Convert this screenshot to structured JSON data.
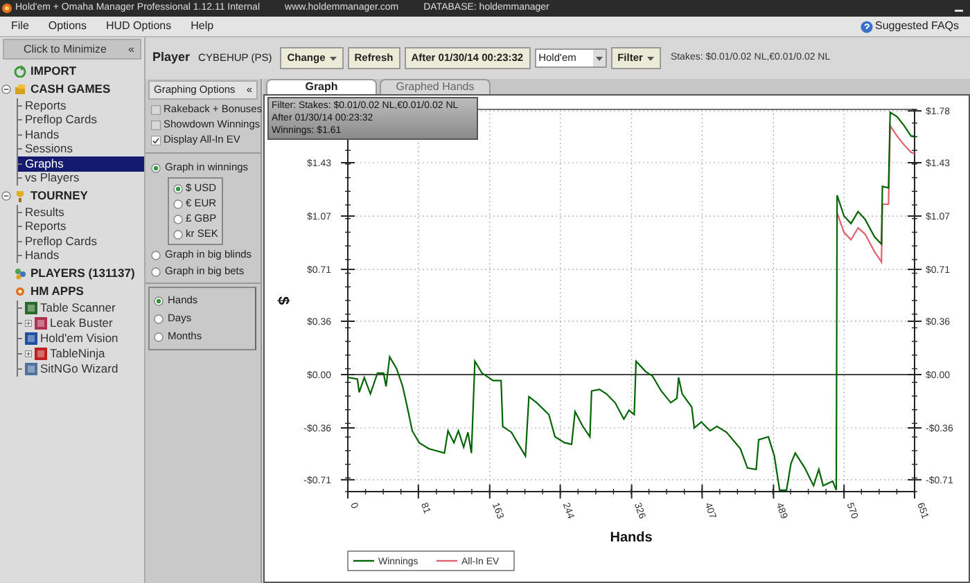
{
  "window": {
    "title": "Hold'em + Omaha Manager Professional 1.12.11 Internal",
    "website": "www.holdemmanager.com",
    "database": "DATABASE: holdemmanager"
  },
  "menu": [
    "File",
    "Options",
    "HUD Options",
    "Help"
  ],
  "help_link": "Suggested FAQs",
  "sidebar": {
    "header": "Click to Minimize",
    "collapse": "«",
    "items": [
      {
        "label": "IMPORT",
        "selected": false
      },
      {
        "label": "CASH GAMES",
        "selected": false,
        "expanded": true,
        "children": [
          {
            "label": "Reports",
            "selected": false
          },
          {
            "label": "Preflop Cards",
            "selected": false
          },
          {
            "label": "Hands",
            "selected": false
          },
          {
            "label": "Sessions",
            "selected": false
          },
          {
            "label": "Graphs",
            "selected": true
          },
          {
            "label": "vs Players",
            "selected": false
          }
        ]
      },
      {
        "label": "TOURNEY",
        "selected": false,
        "expanded": true,
        "children": [
          {
            "label": "Results",
            "selected": false
          },
          {
            "label": "Reports",
            "selected": false
          },
          {
            "label": "Preflop Cards",
            "selected": false
          },
          {
            "label": "Hands",
            "selected": false
          }
        ]
      },
      {
        "label": "PLAYERS (131137)",
        "selected": false
      },
      {
        "label": "HM APPS",
        "selected": false,
        "children": [
          {
            "label": "Table Scanner",
            "selected": false
          },
          {
            "label": "Leak Buster",
            "selected": false,
            "expanded": false
          },
          {
            "label": "Hold'em Vision",
            "selected": false
          },
          {
            "label": "TableNinja",
            "selected": false,
            "expanded": false
          },
          {
            "label": "SitNGo Wizard",
            "selected": false
          }
        ]
      }
    ]
  },
  "toolbar": {
    "player_label": "Player",
    "player": "CYBEHUP (PS)",
    "buttons": [
      {
        "label": "Change",
        "kind": "dropdown"
      },
      {
        "label": "Refresh",
        "kind": "plain"
      },
      {
        "label": "After 01/30/14 00:23:32",
        "kind": "plain"
      }
    ],
    "game": "Hold'em",
    "filter": "Filter",
    "stakes": "Stakes: $0.01/0.02 NL,€0.01/0.02 NL"
  },
  "options": {
    "title": "Graphing Options",
    "collapse": "«",
    "checkboxes": [
      {
        "label": "Rakeback + Bonuses",
        "checked": false
      },
      {
        "label": "Showdown Winnings",
        "checked": false
      },
      {
        "label": "Display All-In EV",
        "checked": true
      }
    ],
    "units": [
      {
        "label": "Graph in winnings",
        "selected": true,
        "currencies": [
          {
            "label": "$ USD",
            "selected": true
          },
          {
            "label": "€ EUR",
            "selected": false
          },
          {
            "label": "£ GBP",
            "selected": false
          },
          {
            "label": "kr SEK",
            "selected": false
          }
        ]
      },
      {
        "label": "Graph in big blinds",
        "selected": false
      },
      {
        "label": "Graph in big bets",
        "selected": false
      }
    ],
    "period": [
      {
        "label": "Hands",
        "selected": true
      },
      {
        "label": "Days",
        "selected": false
      },
      {
        "label": "Months",
        "selected": false
      }
    ]
  },
  "tabs": [
    {
      "label": "Graph",
      "selected": true
    },
    {
      "label": "Graphed Hands",
      "selected": false
    }
  ],
  "filter_box": [
    "Filter: Stakes: $0.01/0.02 NL,€0.01/0.02 NL",
    "After 01/30/14 00:23:32",
    "Winnings: $1.61"
  ],
  "chart_data": {
    "type": "line",
    "grid": true,
    "legend": true,
    "xlabel": "Hands",
    "ylabel": "$",
    "xlim": [
      0,
      651
    ],
    "ylim": [
      -0.79,
      1.79
    ],
    "xticks": [
      0,
      81,
      163,
      244,
      326,
      407,
      489,
      570,
      651
    ],
    "yticks": [
      {
        "value": -0.71,
        "label": "-$0.71"
      },
      {
        "value": -0.36,
        "label": "-$0.36"
      },
      {
        "value": 0,
        "label": "$0.00"
      },
      {
        "value": 0.36,
        "label": "$0.36"
      },
      {
        "value": 0.71,
        "label": "$0.71"
      },
      {
        "value": 1.07,
        "label": "$1.07"
      },
      {
        "value": 1.43,
        "label": "$1.43"
      },
      {
        "value": 1.78,
        "label": "$1.78"
      }
    ],
    "x": [
      0,
      11,
      13,
      19,
      26,
      34,
      41,
      44,
      48,
      56,
      63,
      69,
      74,
      82,
      93,
      111,
      115,
      122,
      127,
      133,
      138,
      142,
      146,
      154,
      167,
      176,
      178,
      188,
      196,
      204,
      208,
      217,
      231,
      238,
      249,
      257,
      261,
      270,
      278,
      280,
      289,
      297,
      307,
      317,
      323,
      329,
      331,
      342,
      350,
      360,
      371,
      378,
      380,
      384,
      395,
      398,
      406,
      416,
      424,
      435,
      451,
      459,
      469,
      472,
      483,
      490,
      496,
      504,
      509,
      514,
      525,
      535,
      541,
      546,
      557,
      561,
      562,
      570,
      578,
      586,
      594,
      605,
      613,
      614,
      621,
      623,
      631,
      639,
      647,
      651
    ],
    "series": [
      {
        "name": "Winnings",
        "color": "#006400",
        "values": [
          -0.02,
          -0.03,
          -0.12,
          -0.02,
          -0.13,
          0.01,
          0.01,
          -0.08,
          0.12,
          0.04,
          -0.08,
          -0.24,
          -0.38,
          -0.46,
          -0.5,
          -0.53,
          -0.38,
          -0.46,
          -0.38,
          -0.49,
          -0.39,
          -0.53,
          0.09,
          0.01,
          -0.04,
          -0.04,
          -0.35,
          -0.39,
          -0.47,
          -0.55,
          -0.15,
          -0.19,
          -0.27,
          -0.42,
          -0.46,
          -0.47,
          -0.25,
          -0.35,
          -0.42,
          -0.11,
          -0.1,
          -0.13,
          -0.19,
          -0.3,
          -0.24,
          -0.27,
          0.09,
          0.02,
          -0.01,
          -0.11,
          -0.19,
          -0.16,
          -0.02,
          -0.13,
          -0.22,
          -0.36,
          -0.32,
          -0.38,
          -0.35,
          -0.39,
          -0.5,
          -0.63,
          -0.64,
          -0.44,
          -0.42,
          -0.55,
          -0.78,
          -0.78,
          -0.6,
          -0.53,
          -0.63,
          -0.75,
          -0.64,
          -0.75,
          -0.72,
          -0.78,
          1.21,
          1.07,
          1.02,
          1.1,
          1.05,
          0.93,
          0.88,
          1.27,
          1.26,
          1.77,
          1.74,
          1.68,
          1.61,
          1.61
        ]
      },
      {
        "name": "All-In EV",
        "color": "#e06070",
        "values": [
          null,
          null,
          null,
          null,
          null,
          null,
          null,
          null,
          null,
          null,
          null,
          null,
          null,
          null,
          null,
          null,
          null,
          null,
          null,
          null,
          null,
          null,
          null,
          null,
          null,
          null,
          null,
          null,
          null,
          null,
          null,
          null,
          null,
          null,
          null,
          null,
          null,
          null,
          null,
          null,
          null,
          null,
          null,
          null,
          null,
          null,
          null,
          null,
          null,
          null,
          null,
          null,
          null,
          null,
          null,
          null,
          null,
          null,
          null,
          null,
          null,
          null,
          null,
          null,
          null,
          null,
          null,
          null,
          null,
          null,
          null,
          null,
          null,
          null,
          null,
          null,
          1.09,
          0.96,
          0.91,
          0.99,
          0.95,
          0.83,
          0.76,
          1.15,
          1.15,
          1.68,
          1.61,
          1.55,
          1.5,
          1.49
        ]
      }
    ]
  }
}
